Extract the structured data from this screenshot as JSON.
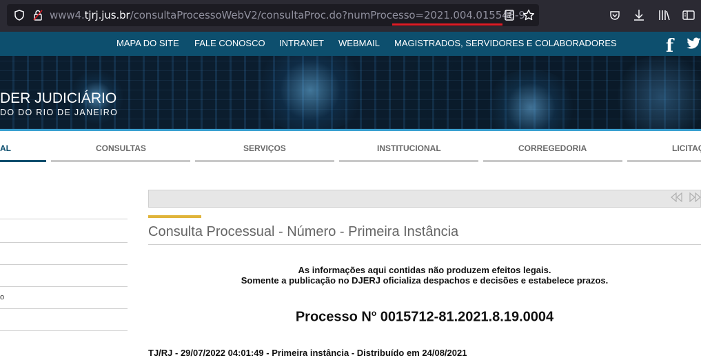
{
  "browser": {
    "url_prefix": "www4.",
    "url_domain": "tjrj.jus.br",
    "url_path": "/consultaProcessoWebV2/consultaProc.do?numProcesso",
    "url_highlight": "=2021.004.015548-9",
    "icons": [
      "shield-icon",
      "lock-icon",
      "reader-view-icon",
      "bookmark-star-icon",
      "pocket-icon",
      "download-icon",
      "library-icon",
      "sidebar-icon"
    ]
  },
  "topnav": {
    "links": [
      "MAPA DO SITE",
      "FALE CONOSCO",
      "INTRANET",
      "WEBMAIL",
      "MAGISTRADOS, SERVIDORES E COLABORADORES"
    ],
    "social": [
      "facebook-icon",
      "twitter-icon"
    ],
    "facebook_glyph": "f"
  },
  "banner": {
    "title": "DER JUDICIÁRIO",
    "subtitle": "DO DO RIO DE JANEIRO"
  },
  "menu": {
    "items": [
      "AL",
      "CONSULTAS",
      "SERVIÇOS",
      "INSTITUCIONAL",
      "CORREGEDORIA",
      "LICITAÇ"
    ],
    "active_color": "#0d4f6e",
    "inactive_color": "#c8c8c8"
  },
  "sidebar": {
    "items": [
      "",
      "",
      "",
      "o",
      ""
    ]
  },
  "content": {
    "nav_first": "«",
    "nav_next": "»",
    "page_title": "Consulta Processual - Número - Primeira Instância",
    "notice_line1": "As informações aqui contidas não produzem efeitos legais.",
    "notice_line2": "Somente a publicação no DJERJ oficializa despachos e decisões e estabelece prazos.",
    "processo_prefix": "Processo N",
    "processo_sup": "o",
    "processo_number": "0015712-81.2021.8.19.0004",
    "bottom_line": "TJ/RJ - 29/07/2022 04:01:49 - Primeira instância - Distribuído em 24/08/2021"
  },
  "colors": {
    "chrome_bg": "#2b2a33",
    "topnav_bg": "#0d4f6e",
    "gold_accent": "#e0b43a",
    "url_underline": "#e01b24"
  }
}
